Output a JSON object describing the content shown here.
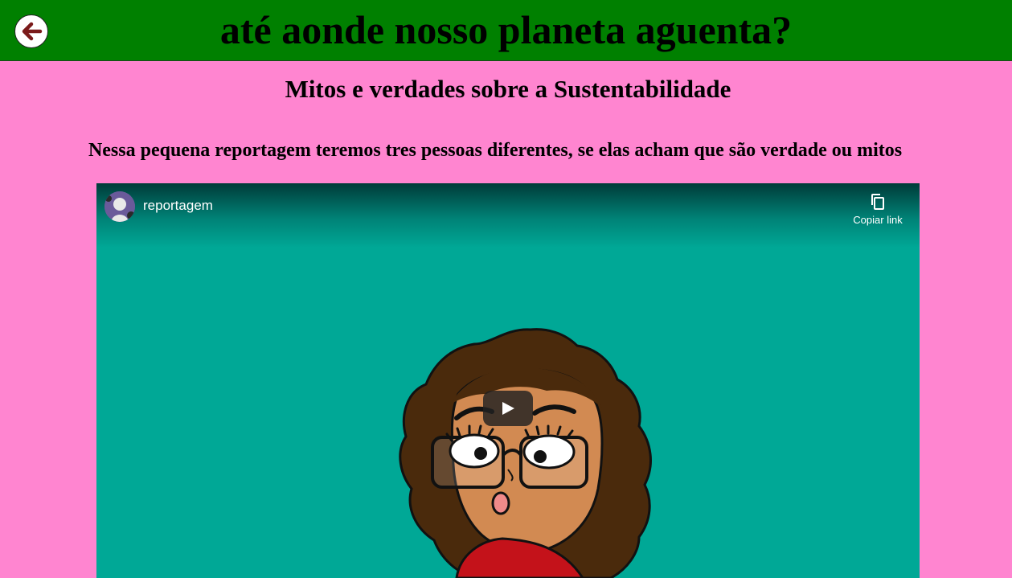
{
  "header": {
    "title": "até aonde nosso planeta aguenta?",
    "back_icon": "arrow-left-icon",
    "color": "#008000"
  },
  "page": {
    "subtitle": "Mitos e verdades sobre a Sustentabilidade",
    "intro": "Nessa pequena reportagem teremos tres pessoas diferentes, se elas acham que são verdade ou mitos",
    "background": "#ff85d0"
  },
  "video": {
    "title": "reportagem",
    "copy_link_label": "Copiar link",
    "copy_icon": "copy-icon",
    "play_icon": "play-icon",
    "background": "#00a896"
  }
}
